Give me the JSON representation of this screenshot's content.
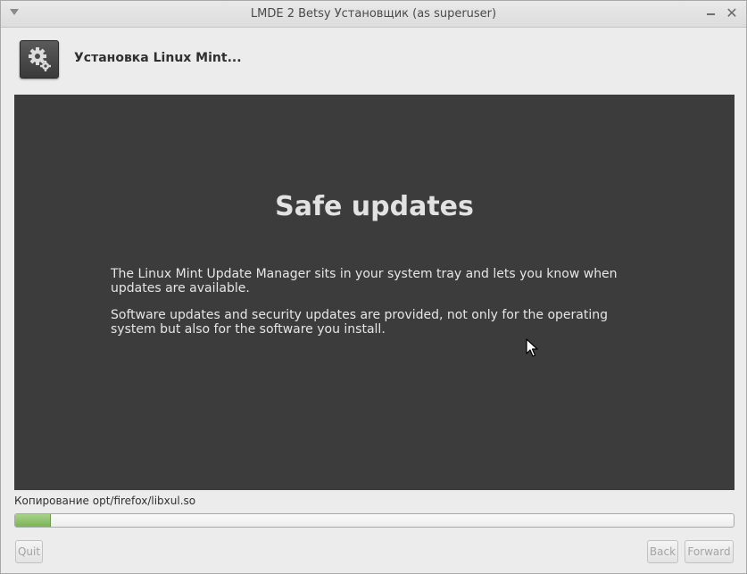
{
  "window": {
    "title": "LMDE 2 Betsy Установщик (as superuser)",
    "close_glyph": "✕",
    "menu_icon": "chevron-down-icon"
  },
  "header": {
    "icon": "gear-icon",
    "title": "Установка Linux Mint..."
  },
  "slide": {
    "heading": "Safe updates",
    "paragraphs": [
      "The Linux Mint Update Manager sits in your system tray and lets you know when updates are available.",
      "Software updates and security updates are provided, not only for the operating system but also for the software you install."
    ],
    "background_color": "#3c3c3c"
  },
  "status": {
    "text": "Копирование opt/firefox/libxul.so"
  },
  "progress": {
    "fraction": 0.05,
    "color": "#7cb35a"
  },
  "buttons": {
    "quit": "Quit",
    "back": "Back",
    "forward": "Forward"
  }
}
